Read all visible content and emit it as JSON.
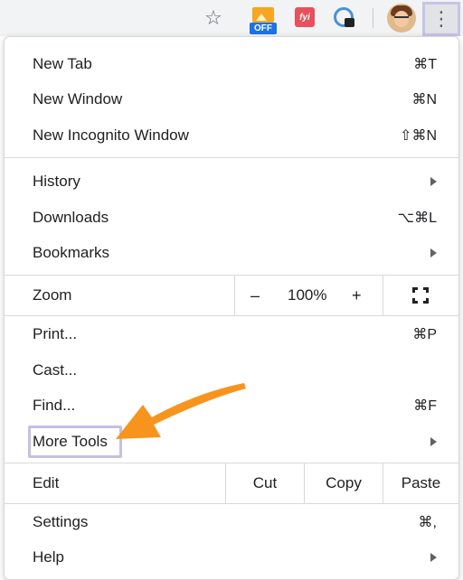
{
  "toolbar": {
    "bookmark_icon": "star-icon",
    "off_extension_label": "OFF",
    "fyi_extension_label": "fyi",
    "menu_icon": "vertical-dots-icon"
  },
  "menu": {
    "group1": [
      {
        "label": "New Tab",
        "shortcut": "⌘T"
      },
      {
        "label": "New Window",
        "shortcut": "⌘N"
      },
      {
        "label": "New Incognito Window",
        "shortcut": "⇧⌘N"
      }
    ],
    "group2": [
      {
        "label": "History",
        "shortcut": ""
      },
      {
        "label": "Downloads",
        "shortcut": "⌥⌘L"
      },
      {
        "label": "Bookmarks",
        "shortcut": ""
      }
    ],
    "zoom": {
      "label": "Zoom",
      "minus": "–",
      "value": "100%",
      "plus": "+"
    },
    "group3": [
      {
        "label": "Print...",
        "shortcut": "⌘P"
      },
      {
        "label": "Cast...",
        "shortcut": ""
      },
      {
        "label": "Find...",
        "shortcut": "⌘F"
      },
      {
        "label": "More Tools",
        "shortcut": ""
      }
    ],
    "edit": {
      "label": "Edit",
      "cut": "Cut",
      "copy": "Copy",
      "paste": "Paste"
    },
    "group4": [
      {
        "label": "Settings",
        "shortcut": "⌘,"
      },
      {
        "label": "Help",
        "shortcut": ""
      }
    ]
  },
  "colors": {
    "annotation_arrow": "#f7941d",
    "highlight_box": "#c5bfe3"
  }
}
